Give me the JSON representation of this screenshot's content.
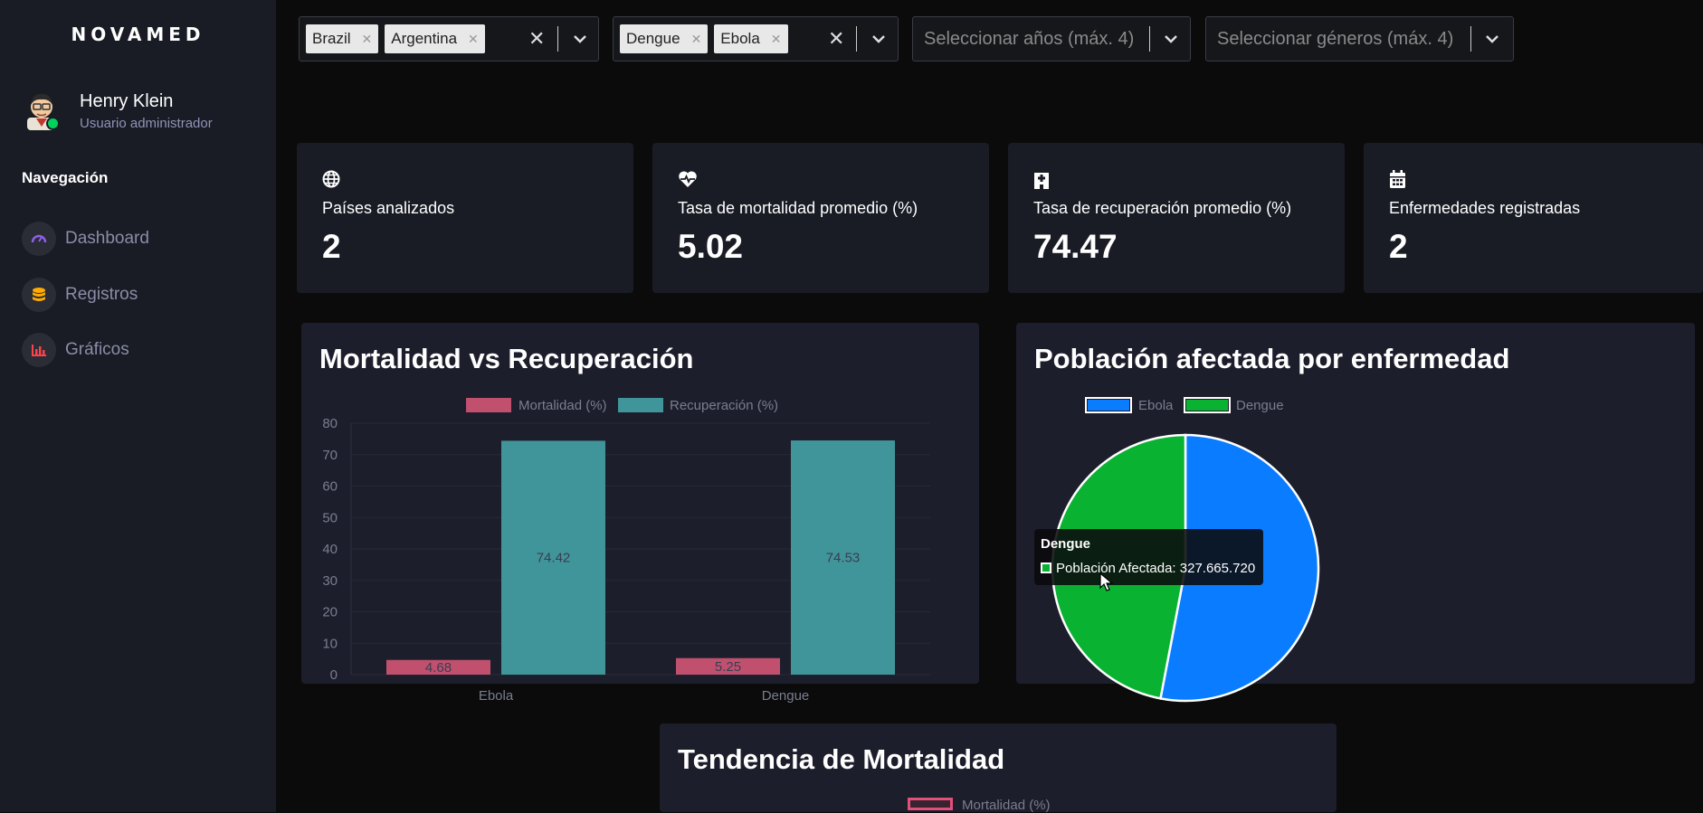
{
  "app": {
    "brand": "NOVAMED"
  },
  "user": {
    "name": "Henry Klein",
    "role": "Usuario administrador"
  },
  "nav": {
    "title": "Navegación",
    "items": [
      {
        "label": "Dashboard",
        "icon": "speedometer-icon",
        "color": "#8f5fe8"
      },
      {
        "label": "Registros",
        "icon": "database-icon",
        "color": "#ffab00"
      },
      {
        "label": "Gráficos",
        "icon": "bar-chart-icon",
        "color": "#fc424a"
      }
    ]
  },
  "filters": {
    "countries": {
      "chips": [
        "Brazil",
        "Argentina"
      ]
    },
    "diseases": {
      "chips": [
        "Dengue",
        "Ebola"
      ]
    },
    "years": {
      "placeholder": "Seleccionar años (máx. 4)"
    },
    "genders": {
      "placeholder": "Seleccionar géneros (máx. 4)"
    }
  },
  "kpis": [
    {
      "label": "Países analizados",
      "value": "2",
      "icon": "globe-icon"
    },
    {
      "label": "Tasa de mortalidad promedio (%)",
      "value": "5.02",
      "icon": "heartbeat-icon"
    },
    {
      "label": "Tasa de recuperación promedio (%)",
      "value": "74.47",
      "icon": "hospital-icon"
    },
    {
      "label": "Enfermedades registradas",
      "value": "2",
      "icon": "calendar-icon"
    }
  ],
  "colors": {
    "mortality": "#c0506e",
    "recovery": "#40959a",
    "ebola": "#0a7cff",
    "dengue": "#0ab232"
  },
  "chart_data": [
    {
      "type": "bar",
      "title": "Mortalidad vs Recuperación",
      "categories": [
        "Ebola",
        "Dengue"
      ],
      "series": [
        {
          "name": "Mortalidad (%)",
          "values": [
            4.68,
            5.25
          ]
        },
        {
          "name": "Recuperación (%)",
          "values": [
            74.42,
            74.53
          ]
        }
      ],
      "yticks": [
        "0",
        "10",
        "20",
        "30",
        "40",
        "50",
        "60",
        "70",
        "80"
      ],
      "ylim": [
        0,
        80
      ],
      "legend": "top",
      "value_labels": [
        "4.68",
        "74.42",
        "5.25",
        "74.53"
      ]
    },
    {
      "type": "pie",
      "title": "Población afectada por enfermedad",
      "labels": [
        "Ebola",
        "Dengue"
      ],
      "values": [
        53,
        47
      ],
      "legend": "top-left"
    },
    {
      "type": "line",
      "title": "Tendencia de Mortalidad",
      "series": [
        {
          "name": "Mortalidad (%)"
        }
      ],
      "legend": "top"
    }
  ],
  "tooltip": {
    "title": "Dengue",
    "text": "Población Afectada: 327.665.720"
  }
}
